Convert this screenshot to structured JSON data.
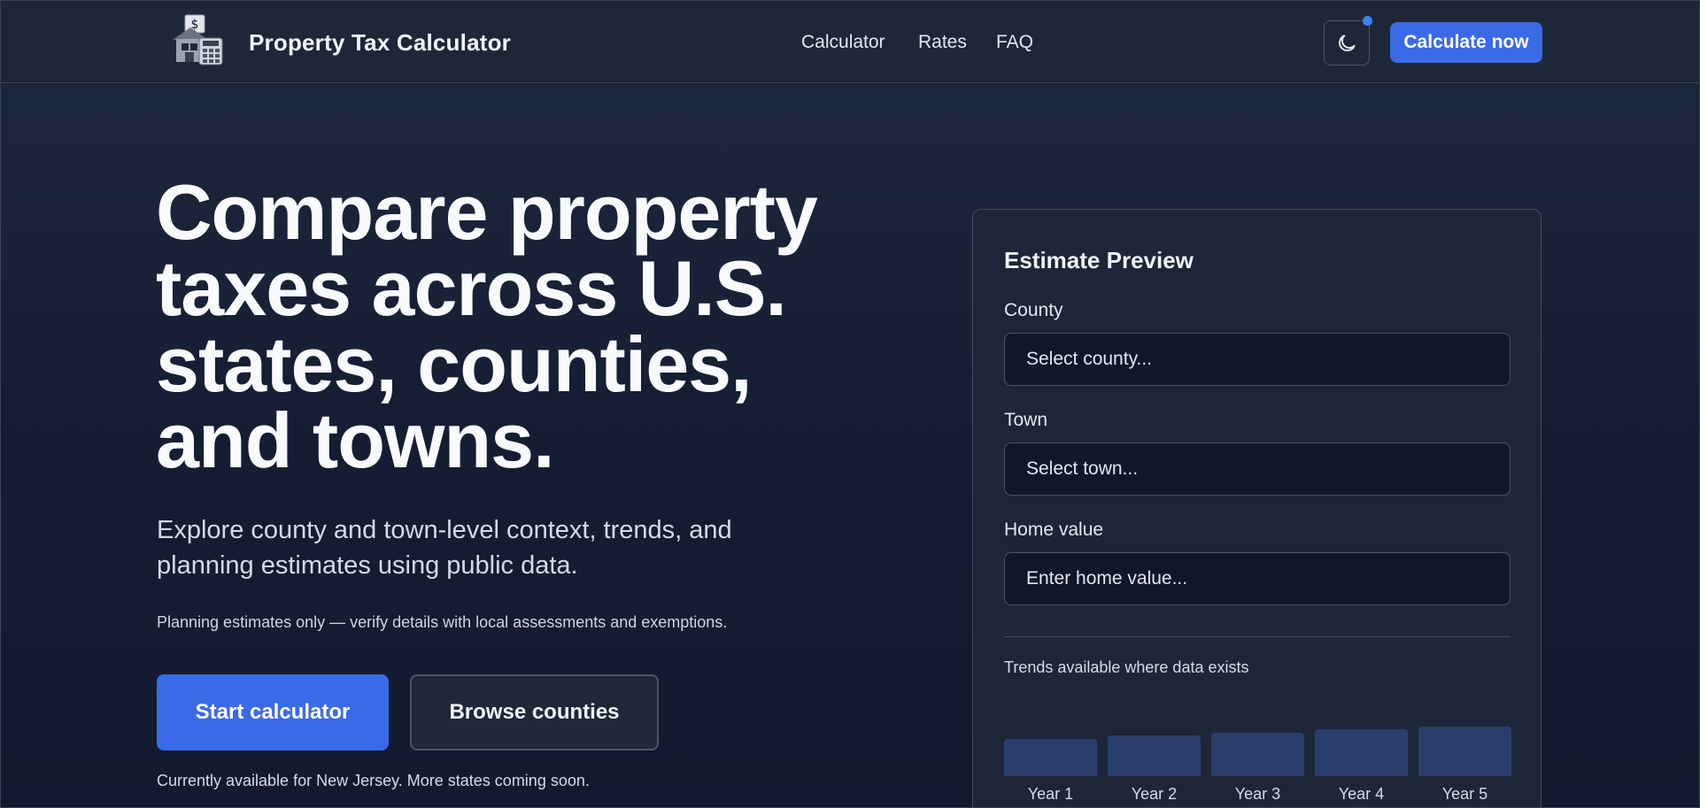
{
  "header": {
    "brand": "Property Tax Calculator",
    "nav": [
      "Calculator",
      "Rates",
      "FAQ"
    ],
    "theme_toggle_icon": "moon-icon",
    "cta_label": "Calculate now",
    "accent_color": "#3a6ae6"
  },
  "hero": {
    "title_lines": [
      "Compare property",
      "taxes across U.S.",
      "states, counties,",
      "and towns."
    ],
    "subtitle_lines": [
      "Explore county and town-level context, trends, and",
      "planning estimates using public data."
    ],
    "note": "Planning estimates only — verify details with local assessments and exemptions.",
    "primary_button": "Start calculator",
    "secondary_button": "Browse counties",
    "availability": "Currently available for New Jersey. More states coming soon."
  },
  "estimate": {
    "title": "Estimate Preview",
    "county_label": "County",
    "county_placeholder": "Select county...",
    "town_label": "Town",
    "town_placeholder": "Select town...",
    "home_value_label": "Home value",
    "home_value_placeholder": "Enter home value...",
    "trends_label": "Trends available where data exists"
  },
  "chart_data": {
    "type": "bar",
    "categories": [
      "Year 1",
      "Year 2",
      "Year 3",
      "Year 4",
      "Year 5"
    ],
    "values": [
      55,
      60,
      65,
      70,
      74
    ],
    "ylim": [
      0,
      100
    ],
    "grid": false,
    "color": "#2a3e6e"
  }
}
